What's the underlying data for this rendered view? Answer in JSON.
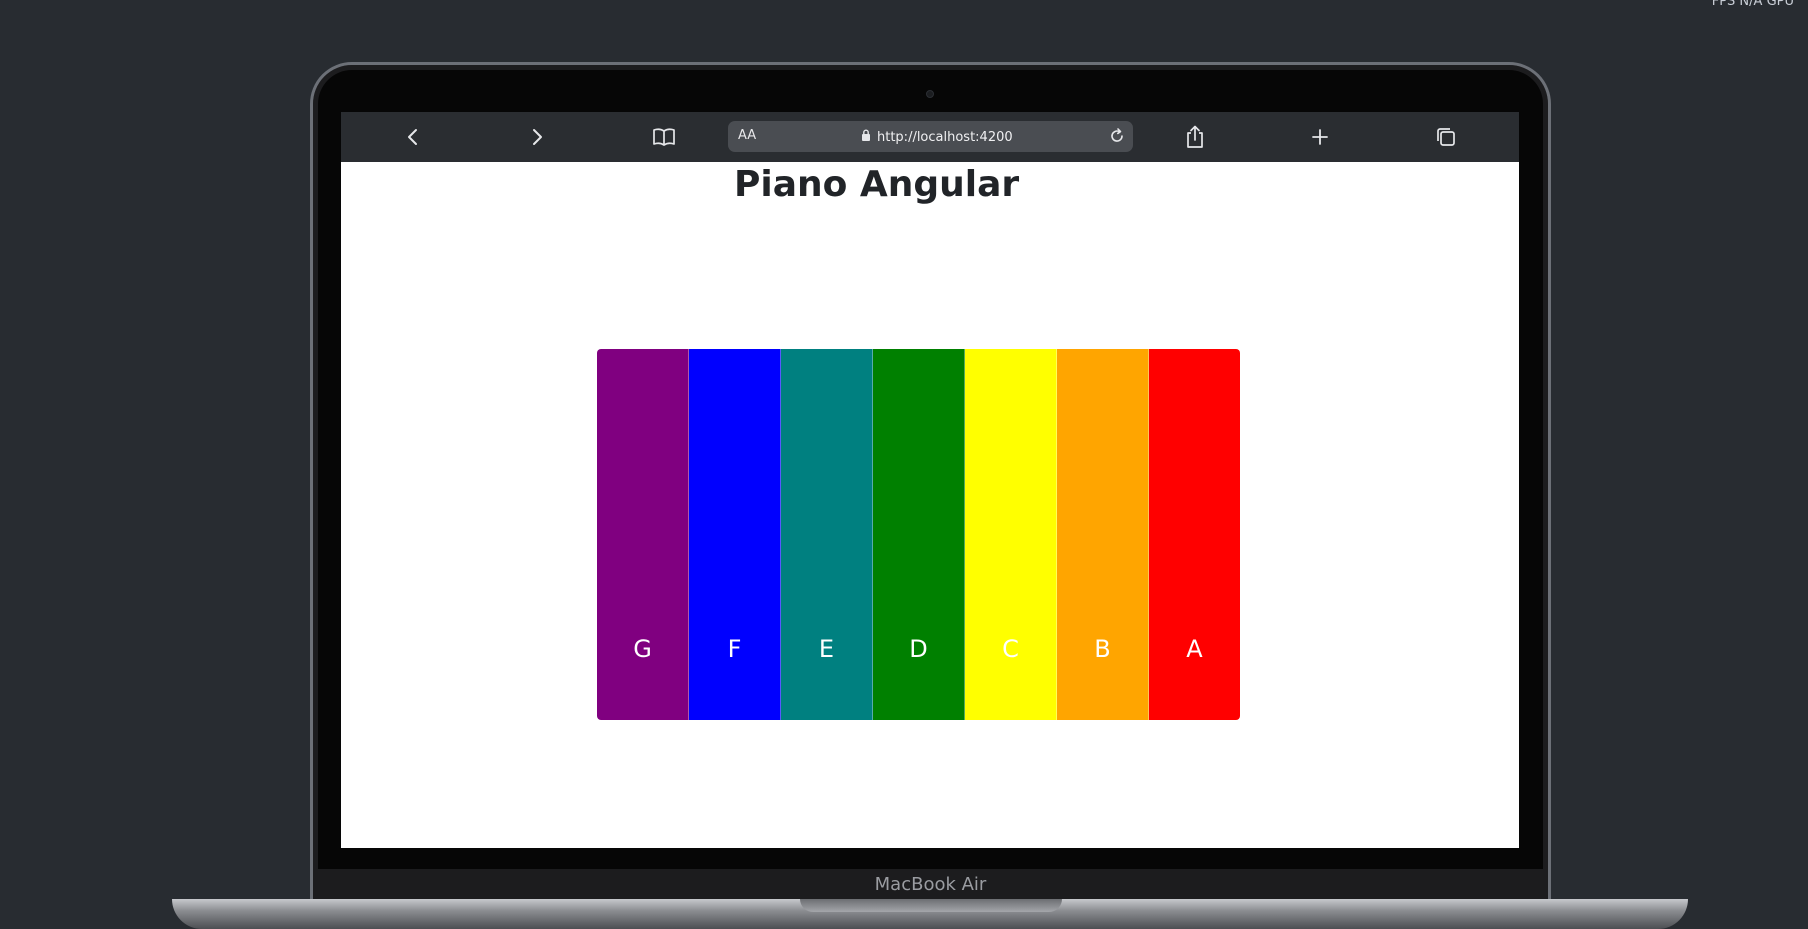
{
  "status_corner": "FPS N/A GPU",
  "browser": {
    "reader_label": "AA",
    "url": "http://localhost:4200"
  },
  "page": {
    "title": "Piano Angular"
  },
  "piano": {
    "keys": [
      {
        "label": "G",
        "color": "#800080"
      },
      {
        "label": "F",
        "color": "#0000ff"
      },
      {
        "label": "E",
        "color": "#008080"
      },
      {
        "label": "D",
        "color": "#008000"
      },
      {
        "label": "C",
        "color": "#ffff00"
      },
      {
        "label": "B",
        "color": "#ffa500"
      },
      {
        "label": "A",
        "color": "#ff0000"
      }
    ]
  },
  "device": {
    "name": "MacBook Air"
  }
}
